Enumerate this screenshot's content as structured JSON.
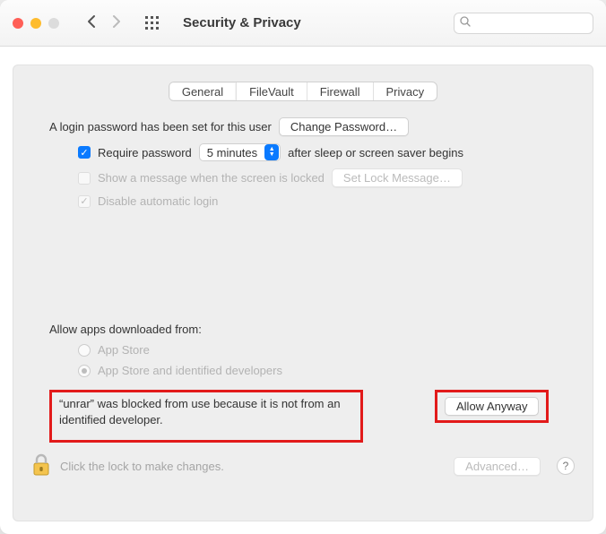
{
  "window": {
    "title": "Security & Privacy"
  },
  "search": {
    "placeholder": ""
  },
  "tabs": [
    "General",
    "FileVault",
    "Firewall",
    "Privacy"
  ],
  "login": {
    "text": "A login password has been set for this user",
    "change_btn": "Change Password…"
  },
  "require": {
    "label": "Require password",
    "delay": "5 minutes",
    "after": "after sleep or screen saver begins"
  },
  "show_message": {
    "label": "Show a message when the screen is locked",
    "btn": "Set Lock Message…"
  },
  "disable_auto": "Disable automatic login",
  "allow_apps": {
    "heading": "Allow apps downloaded from:",
    "opt1": "App Store",
    "opt2": "App Store and identified developers"
  },
  "blocked": {
    "msg": "“unrar” was blocked from use because it is not from an identified developer.",
    "allow_btn": "Allow Anyway"
  },
  "footer": {
    "lock_text": "Click the lock to make changes.",
    "advanced_btn": "Advanced…",
    "help": "?"
  }
}
